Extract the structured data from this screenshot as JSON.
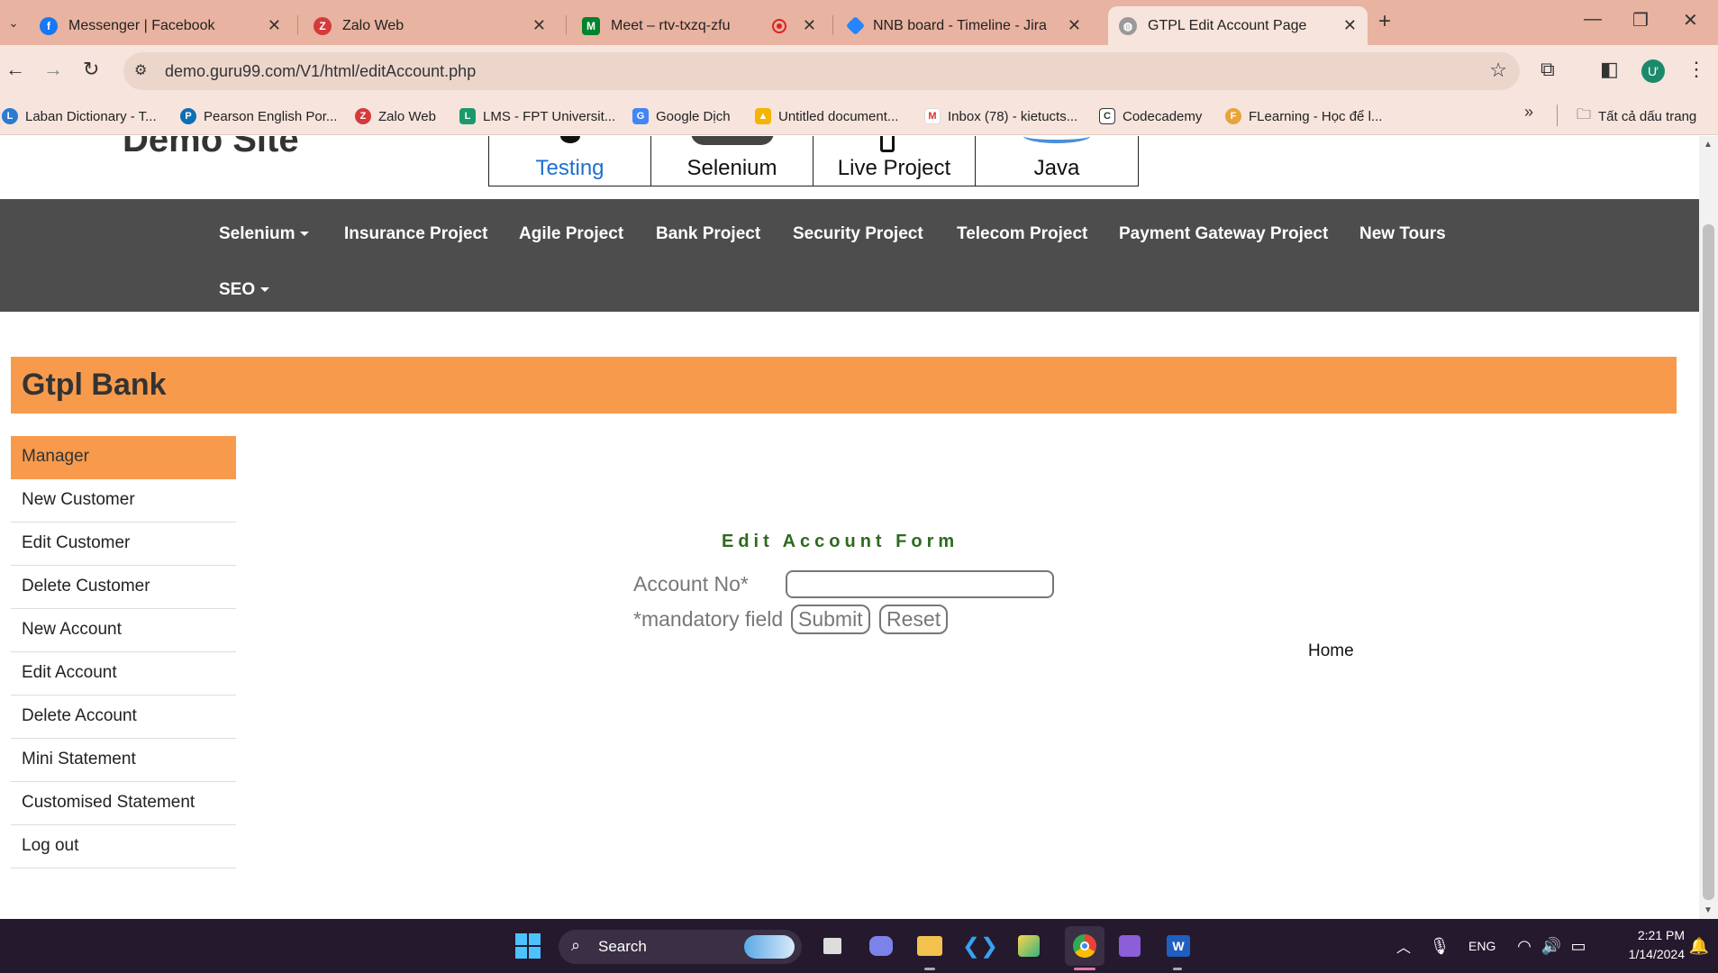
{
  "browser": {
    "tabs": [
      {
        "title": "Messenger | Facebook",
        "icon": "facebook-icon",
        "color": "#1877f2",
        "active": false
      },
      {
        "title": "Zalo Web",
        "icon": "zalo-icon",
        "color": "#d33b3b",
        "active": false
      },
      {
        "title": "Meet – rtv-txzq-zfu",
        "icon": "meet-icon",
        "color": "#00832d",
        "active": false
      },
      {
        "title": "NNB board - Timeline - Jira",
        "icon": "jira-icon",
        "color": "#2684ff",
        "active": false
      },
      {
        "title": "GTPL Edit Account Page",
        "icon": "globe-icon",
        "color": "#888888",
        "active": true
      }
    ],
    "url": "demo.guru99.com/V1/html/editAccount.php",
    "profile_initial": "Ư",
    "bookmarks": [
      {
        "label": "Laban Dictionary - T...",
        "icon": "laban-icon",
        "color": "#2b7bd0"
      },
      {
        "label": "Pearson English Por...",
        "icon": "pearson-icon",
        "color": "#0d6eb5"
      },
      {
        "label": "Zalo Web",
        "icon": "zalo-icon",
        "color": "#d33b3b"
      },
      {
        "label": "LMS - FPT Universit...",
        "icon": "lms-icon",
        "color": "#1a9a6c"
      },
      {
        "label": "Google Dịch",
        "icon": "google-translate-icon",
        "color": "#4285f4"
      },
      {
        "label": "Untitled document...",
        "icon": "google-drive-icon",
        "color": "#f4b400"
      },
      {
        "label": "Inbox (78) - kietucts...",
        "icon": "gmail-icon",
        "color": "#d93025"
      },
      {
        "label": "Codecademy",
        "icon": "codecademy-icon",
        "color": "#333333"
      },
      {
        "label": "FLearning - Học để l...",
        "icon": "flearning-icon",
        "color": "#e8a33c"
      }
    ],
    "all_bookmarks": "Tất cả dấu trang"
  },
  "site": {
    "title": "Demo Site",
    "courses": [
      "Testing",
      "Selenium",
      "Live Project",
      "Java"
    ],
    "nav": [
      "Selenium",
      "Insurance Project",
      "Agile Project",
      "Bank Project",
      "Security Project",
      "Telecom Project",
      "Payment Gateway Project",
      "New Tours",
      "SEO"
    ]
  },
  "bank": {
    "title": "Gtpl Bank",
    "menu": [
      "Manager",
      "New Customer",
      "Edit Customer",
      "Delete Customer",
      "New Account",
      "Edit Account",
      "Delete Account",
      "Mini Statement",
      "Customised Statement",
      "Log out"
    ],
    "form": {
      "title": "Edit Account Form",
      "account_label": "Account No*",
      "account_value": "",
      "mandatory_note": "*mandatory field",
      "submit": "Submit",
      "reset": "Reset"
    },
    "home_link": "Home"
  },
  "taskbar": {
    "search": "Search",
    "lang": "ENG",
    "time": "2:21 PM",
    "date": "1/14/2024"
  },
  "colors": {
    "accent": "#f79a4c",
    "nav_bg": "#4d4d4d",
    "form_title": "#2e6a1f"
  }
}
